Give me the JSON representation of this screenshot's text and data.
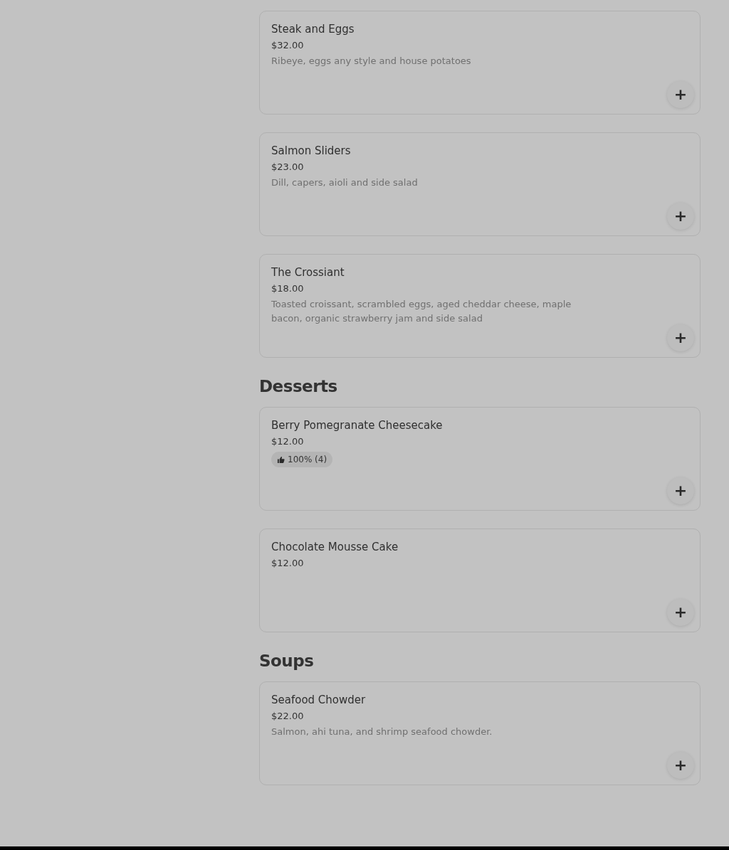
{
  "sections": [
    {
      "items": [
        {
          "name": "Steak and Eggs",
          "price": "$32.00",
          "description": "Ribeye, eggs any style and house potatoes",
          "add": "+"
        },
        {
          "name": "Salmon Sliders",
          "price": "$23.00",
          "description": "Dill, capers, aioli and side salad",
          "add": "+"
        },
        {
          "name": "The Crossiant",
          "price": "$18.00",
          "description": "Toasted croissant, scrambled eggs, aged cheddar cheese, maple bacon, organic strawberry jam and side salad",
          "add": "+"
        }
      ]
    },
    {
      "heading": "Desserts",
      "items": [
        {
          "name": "Berry Pomegranate Cheesecake",
          "price": "$12.00",
          "rating": "100% (4)",
          "add": "+"
        },
        {
          "name": "Chocolate Mousse Cake",
          "price": "$12.00",
          "add": "+"
        }
      ]
    },
    {
      "heading": "Soups",
      "items": [
        {
          "name": "Seafood Chowder",
          "price": "$22.00",
          "description": "Salmon, ahi tuna, and shrimp seafood chowder.",
          "add": "+"
        }
      ]
    }
  ]
}
